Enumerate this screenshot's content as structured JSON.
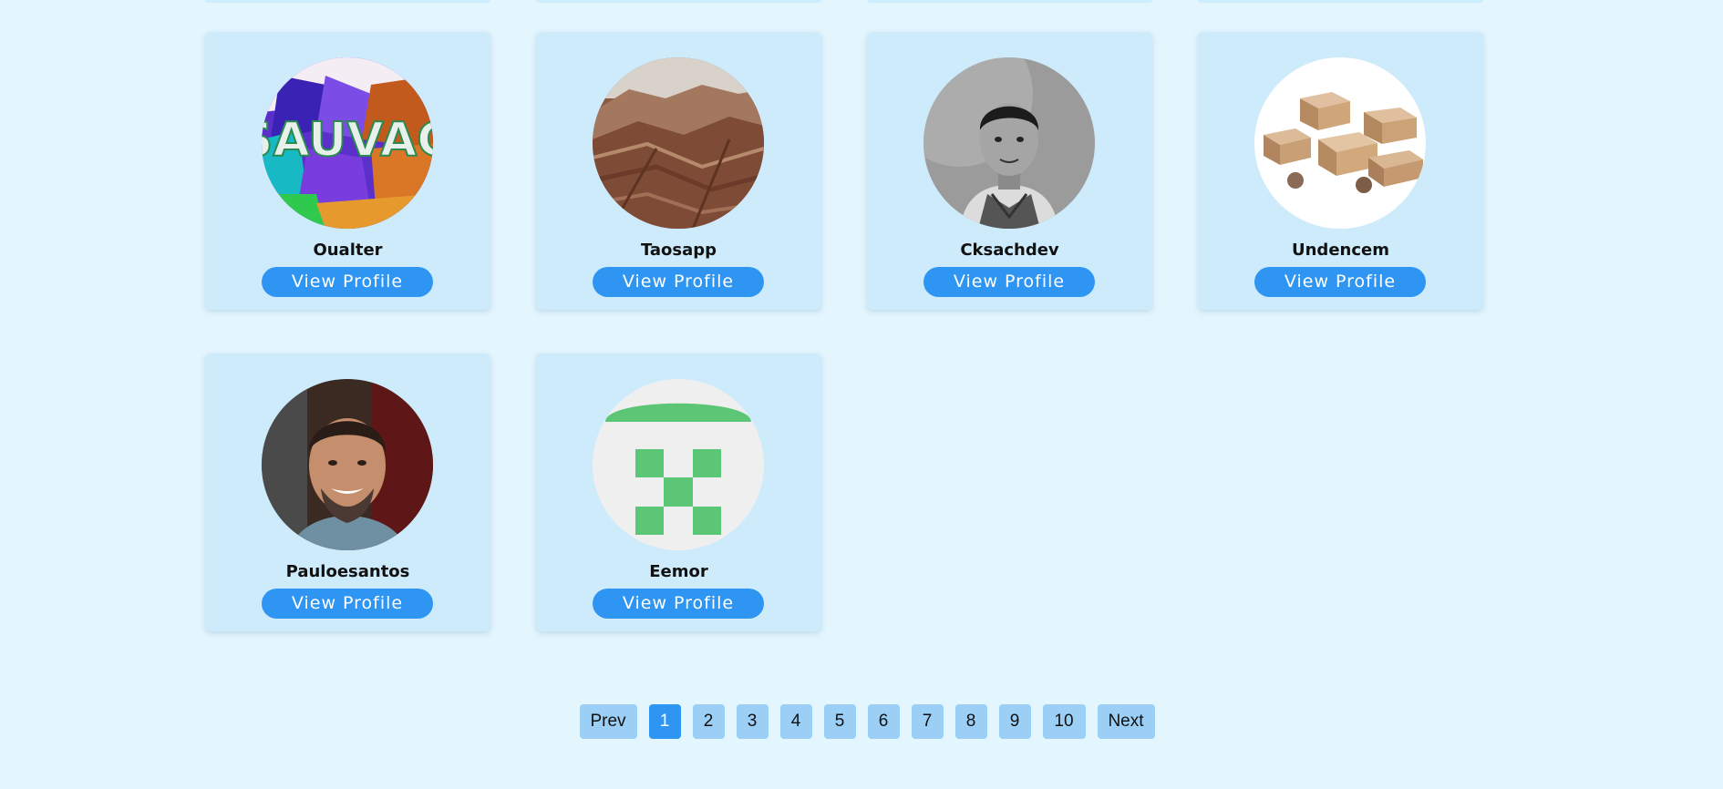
{
  "profiles": [
    {
      "name": "Oualter",
      "button": "View Profile",
      "avatar": "graffiti-sauvage-image"
    },
    {
      "name": "Taosapp",
      "button": "View Profile",
      "avatar": "mountain-landscape-image"
    },
    {
      "name": "Cksachdev",
      "button": "View Profile",
      "avatar": "man-portrait-bw-image"
    },
    {
      "name": "Undencem",
      "button": "View Profile",
      "avatar": "cardboard-boxes-image"
    },
    {
      "name": "Pauloesantos",
      "button": "View Profile",
      "avatar": "smiling-man-portrait-image"
    },
    {
      "name": "Eemor",
      "button": "View Profile",
      "avatar": "green-identicon-image"
    }
  ],
  "pagination": {
    "prev": "Prev",
    "pages": [
      "1",
      "2",
      "3",
      "4",
      "5",
      "6",
      "7",
      "8",
      "9",
      "10"
    ],
    "next": "Next",
    "current": "1"
  },
  "avatar_text": {
    "sauvage": "SAUVAG"
  },
  "colors": {
    "page_bg": "#e3f5fd",
    "card_bg": "#cdebfb",
    "accent": "#2f95f3",
    "page_button": "#9ccff6"
  }
}
